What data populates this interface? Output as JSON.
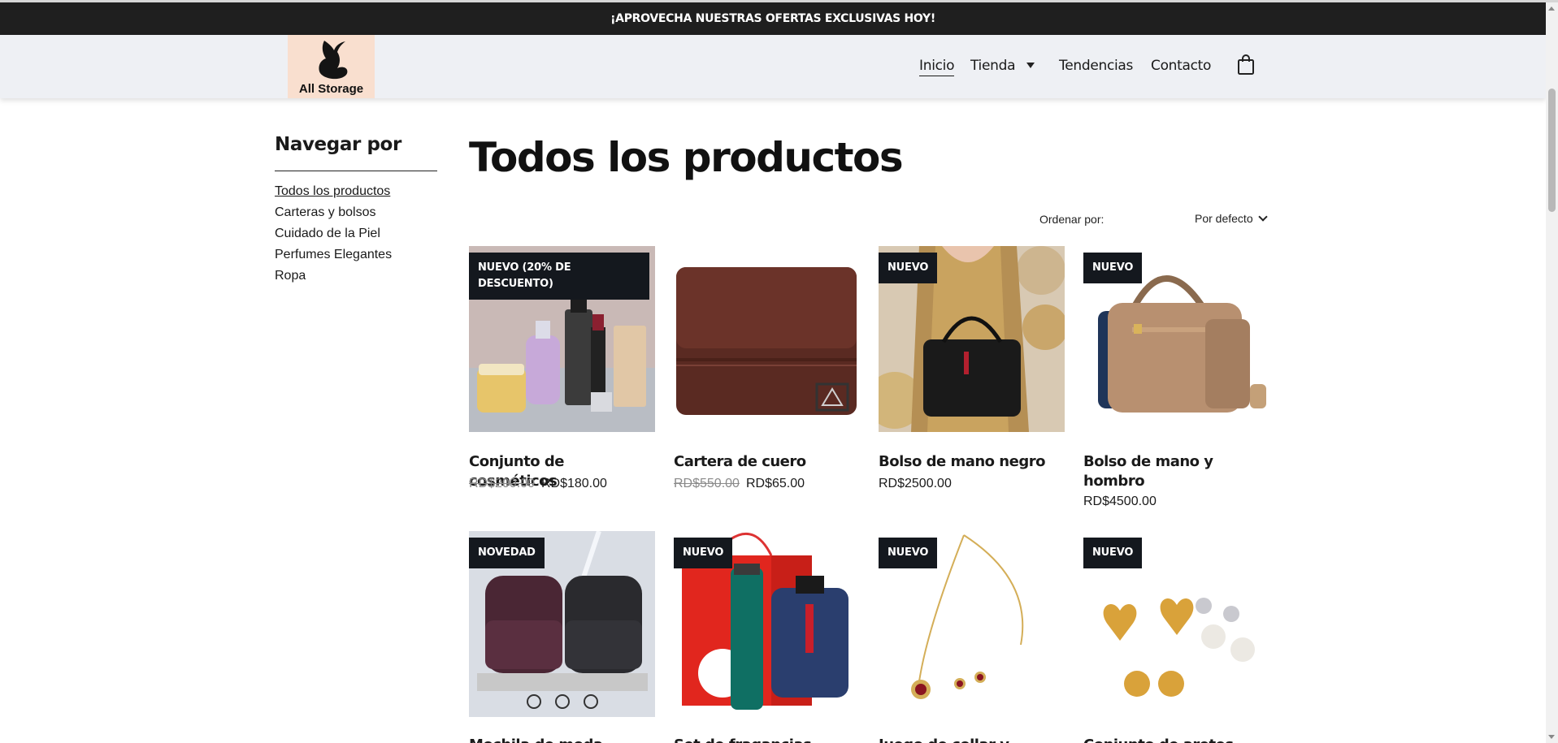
{
  "promo": {
    "text": "¡APROVECHA NUESTRAS OFERTAS EXCLUSIVAS HOY!"
  },
  "header": {
    "logo_text": "All Storage",
    "nav": [
      "Inicio",
      "Tienda",
      "Tendencias",
      "Contacto"
    ],
    "active": "Inicio",
    "icons": {
      "cart": "shopping-bag-icon",
      "dropdown": "caret-down-icon"
    }
  },
  "sidebar": {
    "title": "Navegar por",
    "items": [
      "Todos los productos",
      "Carteras y bolsos",
      "Cuidado de la Piel",
      "Perfumes Elegantes",
      "Ropa"
    ],
    "active": "Todos los productos"
  },
  "main": {
    "title": "Todos los productos",
    "sort_label": "Ordenar por:",
    "sort_value": "Por defecto"
  },
  "products": [
    {
      "name": "Conjunto de cosméticos",
      "badge": "NUEVO (20% DE DESCUENTO)",
      "old_price": "RD$200.00",
      "price": "RD$180.00"
    },
    {
      "name": "Cartera de cuero",
      "badge": "",
      "old_price": "RD$550.00",
      "price": "RD$65.00"
    },
    {
      "name": "Bolso de mano negro",
      "badge": "NUEVO",
      "old_price": "",
      "price": "RD$2500.00"
    },
    {
      "name": "Bolso de mano y hombro",
      "badge": "NUEVO",
      "old_price": "",
      "price": "RD$4500.00"
    },
    {
      "name": "Mochila de moda",
      "badge": "NOVEDAD",
      "old_price": "",
      "price": ""
    },
    {
      "name": "Set de fragancias",
      "badge": "NUEVO",
      "old_price": "",
      "price": ""
    },
    {
      "name": "Juego de collar y",
      "badge": "NUEVO",
      "old_price": "",
      "price": ""
    },
    {
      "name": "Conjunto de aretes",
      "badge": "NUEVO",
      "old_price": "",
      "price": ""
    }
  ],
  "colors": {
    "promo_bg": "#1f1f1f",
    "header_bg": "#eef0f4",
    "badge_bg": "#14181e",
    "logo_bg": "#f9dfcf"
  }
}
